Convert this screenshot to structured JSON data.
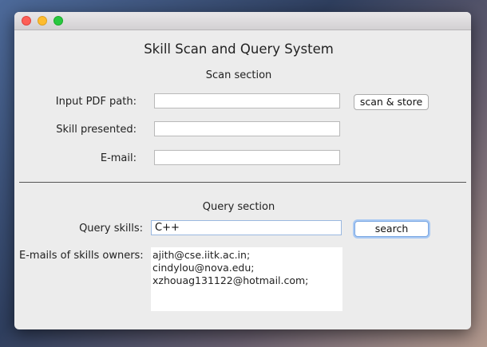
{
  "window": {
    "app_title": "Skill Scan and Query System"
  },
  "scan": {
    "section_title": "Scan section",
    "pdf_path_label": "Input PDF path:",
    "pdf_path_value": "",
    "scan_button_label": "scan & store",
    "skill_label": "Skill presented:",
    "skill_value": "",
    "email_label": "E-mail:",
    "email_value": ""
  },
  "divider_text": "",
  "query": {
    "section_title": "Query section",
    "skills_label": "Query skills:",
    "skills_value": "C++",
    "search_button_label": "search",
    "owners_label": "E-mails of skills owners:",
    "owners_emails": [
      "ajith@cse.iitk.ac.in;",
      "cindylou@nova.edu;",
      "xzhouag131122@hotmail.com;"
    ]
  }
}
